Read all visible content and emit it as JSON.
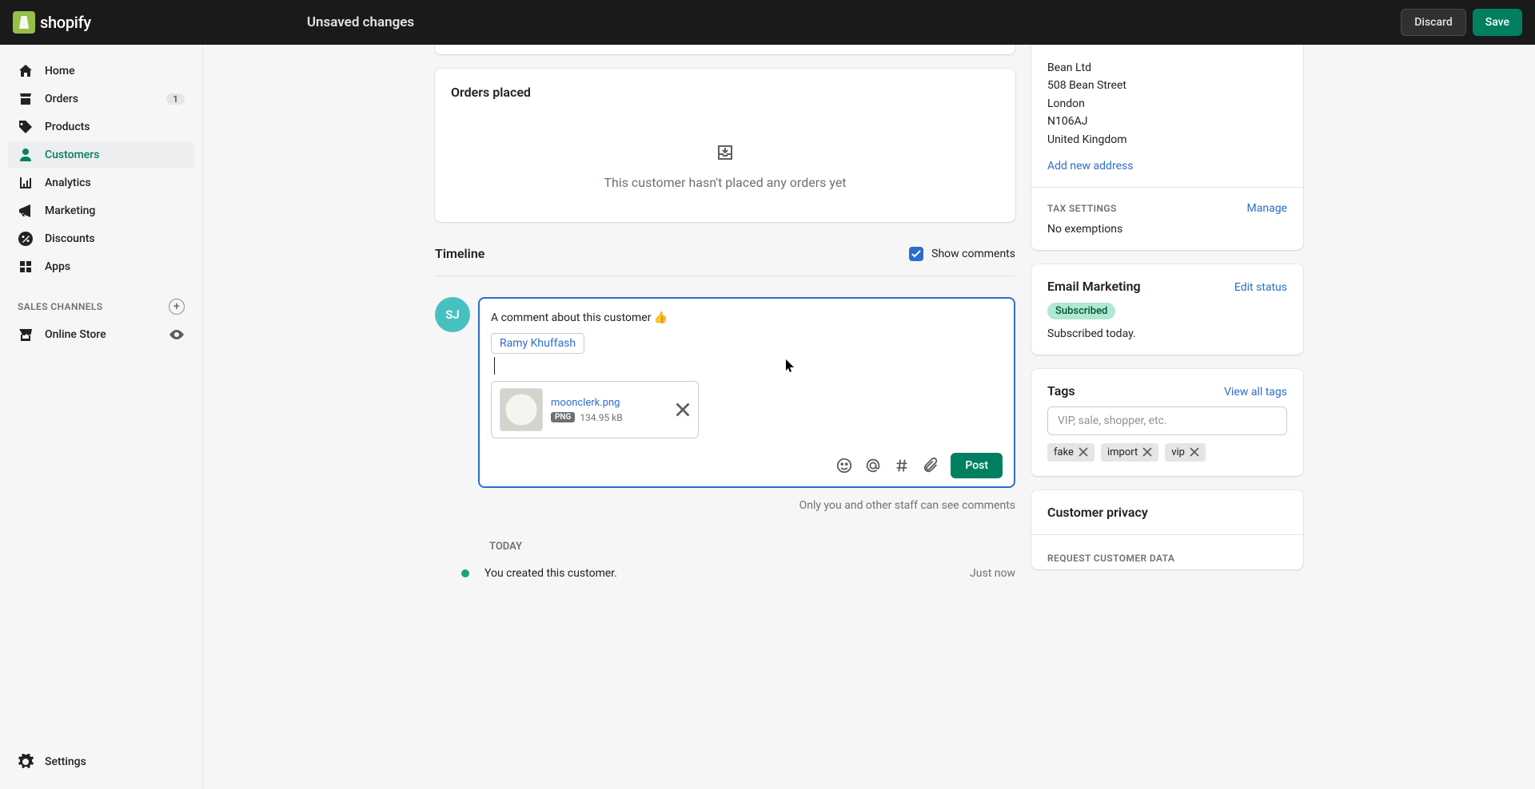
{
  "topbar": {
    "title": "Unsaved changes",
    "discard": "Discard",
    "save": "Save",
    "brand": "shopify"
  },
  "nav": {
    "home": "Home",
    "orders": "Orders",
    "orders_badge": "1",
    "products": "Products",
    "customers": "Customers",
    "analytics": "Analytics",
    "marketing": "Marketing",
    "discounts": "Discounts",
    "apps": "Apps",
    "sales_channels": "SALES CHANNELS",
    "online_store": "Online Store",
    "settings": "Settings"
  },
  "orders_card": {
    "title": "Orders placed",
    "empty": "This customer hasn't placed any orders yet"
  },
  "timeline": {
    "title": "Timeline",
    "show_comments": "Show comments",
    "avatar_initials": "SJ",
    "comment_text": "A comment about this customer 👍",
    "mention": "Ramy Khuffash",
    "attachment": {
      "name": "moonclerk.png",
      "type": "PNG",
      "size": "134.95 kB"
    },
    "post": "Post",
    "hint": "Only you and other staff can see comments",
    "section": "TODAY",
    "entry_text": "You created this customer.",
    "entry_time": "Just now"
  },
  "address": {
    "name": "Bean Ltd",
    "street": "508 Bean Street",
    "city": "London",
    "postal": "N106AJ",
    "country": "United Kingdom",
    "add_new": "Add new address"
  },
  "tax": {
    "title": "TAX SETTINGS",
    "manage": "Manage",
    "body": "No exemptions"
  },
  "email_marketing": {
    "title": "Email Marketing",
    "edit": "Edit status",
    "badge": "Subscribed",
    "body": "Subscribed today."
  },
  "tags": {
    "title": "Tags",
    "view_all": "View all tags",
    "placeholder": "VIP, sale, shopper, etc.",
    "list": [
      "fake",
      "import",
      "vip"
    ]
  },
  "privacy": {
    "title": "Customer privacy",
    "request": "REQUEST CUSTOMER DATA"
  }
}
